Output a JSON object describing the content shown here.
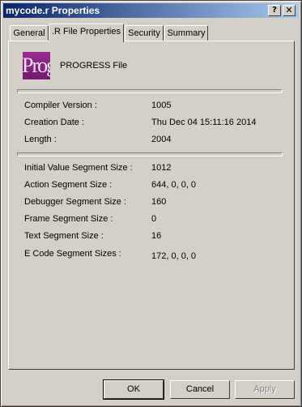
{
  "window": {
    "title": "mycode.r Properties"
  },
  "titlebar_buttons": {
    "help": "?",
    "close": "✕"
  },
  "tabs": [
    {
      "label": "General"
    },
    {
      "label": ".R File Properties"
    },
    {
      "label": "Security"
    },
    {
      "label": "Summary"
    }
  ],
  "active_tab": ".R File Properties",
  "header": {
    "logo_text": "Prog",
    "file_type": "PROGRESS File",
    "logo_colors": [
      "#9a2a93",
      "#6f1c6c"
    ]
  },
  "section1": [
    {
      "label": "Compiler Version :",
      "value": "1005"
    },
    {
      "label": "Creation Date :",
      "value": "Thu Dec 04 15:11:16 2014"
    },
    {
      "label": "Length :",
      "value": "2004"
    }
  ],
  "section2": [
    {
      "label": "Initial Value Segment Size :",
      "value": "1012"
    },
    {
      "label": "Action Segment Size :",
      "value": "644, 0, 0, 0"
    },
    {
      "label": "Debugger Segment Size :",
      "value": "160"
    },
    {
      "label": "Frame Segment Size :",
      "value": "0"
    },
    {
      "label": "Text Segment Size :",
      "value": "16"
    },
    {
      "label": "E Code Segment Sizes :",
      "value": "172, 0, 0, 0"
    }
  ],
  "buttons": {
    "ok": "OK",
    "cancel": "Cancel",
    "apply": "Apply"
  }
}
